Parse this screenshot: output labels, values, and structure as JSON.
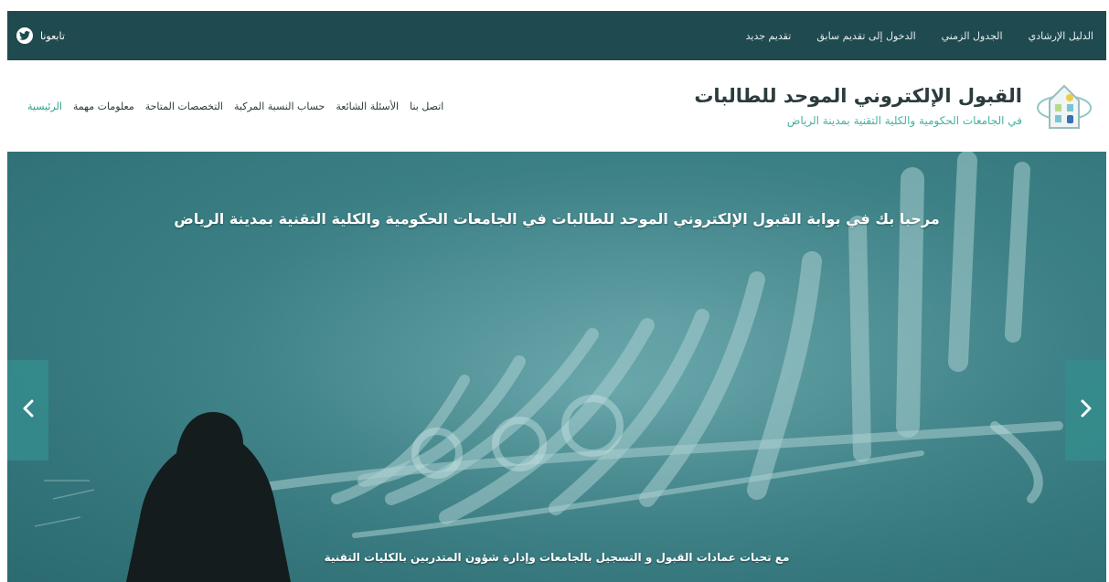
{
  "topbar": {
    "social_label": "تابعونا",
    "links": [
      {
        "label": "تقديم جديد"
      },
      {
        "label": "الدخول إلى تقديم سابق"
      },
      {
        "label": "الجدول الزمني"
      },
      {
        "label": "الدليل الإرشادي"
      }
    ]
  },
  "brand": {
    "title": "القبول الإلكتروني الموحد للطالبات",
    "subtitle": "في الجامعات الحكومية والكلية التقنية بمدينة الرياض"
  },
  "nav": {
    "items": [
      {
        "label": "الرئيسية",
        "active": true
      },
      {
        "label": "معلومات مهمة",
        "active": false
      },
      {
        "label": "التخصصات المتاحة",
        "active": false
      },
      {
        "label": "حساب النسبة المركبة",
        "active": false
      },
      {
        "label": "الأسئلة الشائعة",
        "active": false
      },
      {
        "label": "اتصل بنا",
        "active": false
      }
    ]
  },
  "hero": {
    "title": "مرحبا بك في بوابة القبول الإلكتروني الموحد للطالبات في الجامعات الحكومية والكلية التقنية بمدينة الرياض",
    "caption": "مع تحيات عمادات القبول و التسجيل بالجامعات وإدارة شؤون المتدربين بالكليات التقنية"
  },
  "icons": {
    "social": "twitter-icon",
    "prev": "chevron-left-icon",
    "next": "chevron-right-icon",
    "logo": "logo-icon"
  },
  "colors": {
    "topbar_bg": "#1f4a50",
    "accent": "#2f9e8f",
    "hero_bg": "#3c8186",
    "arrow_bg": "#358c8c"
  }
}
